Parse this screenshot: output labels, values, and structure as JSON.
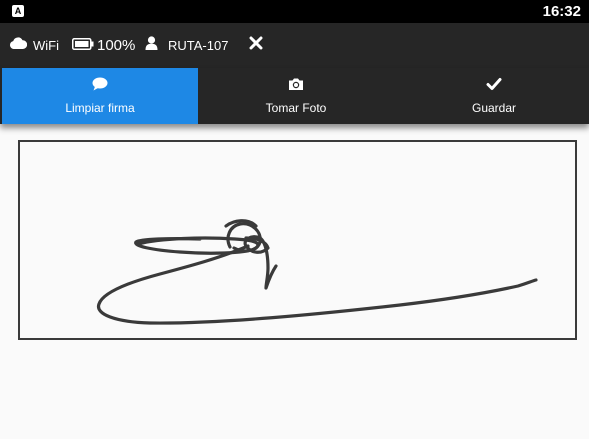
{
  "status_bar": {
    "app_badge": "A",
    "clock": "16:32"
  },
  "info_bar": {
    "wifi_label": "WiFi",
    "battery_label": "100%",
    "user_label": "RUTA-107",
    "icons": [
      "cloud-icon",
      "battery-icon",
      "user-icon",
      "close-icon"
    ]
  },
  "toolbar": {
    "tabs": [
      {
        "label": "Limpiar firma",
        "icon": "comment-icon",
        "active": true
      },
      {
        "label": "Tomar Foto",
        "icon": "camera-icon",
        "active": false
      },
      {
        "label": "Guardar",
        "icon": "check-icon",
        "active": false
      }
    ]
  },
  "colors": {
    "accent": "#1e88e5",
    "bar": "#262626",
    "status": "#000000",
    "ink": "#3a3a3a"
  }
}
